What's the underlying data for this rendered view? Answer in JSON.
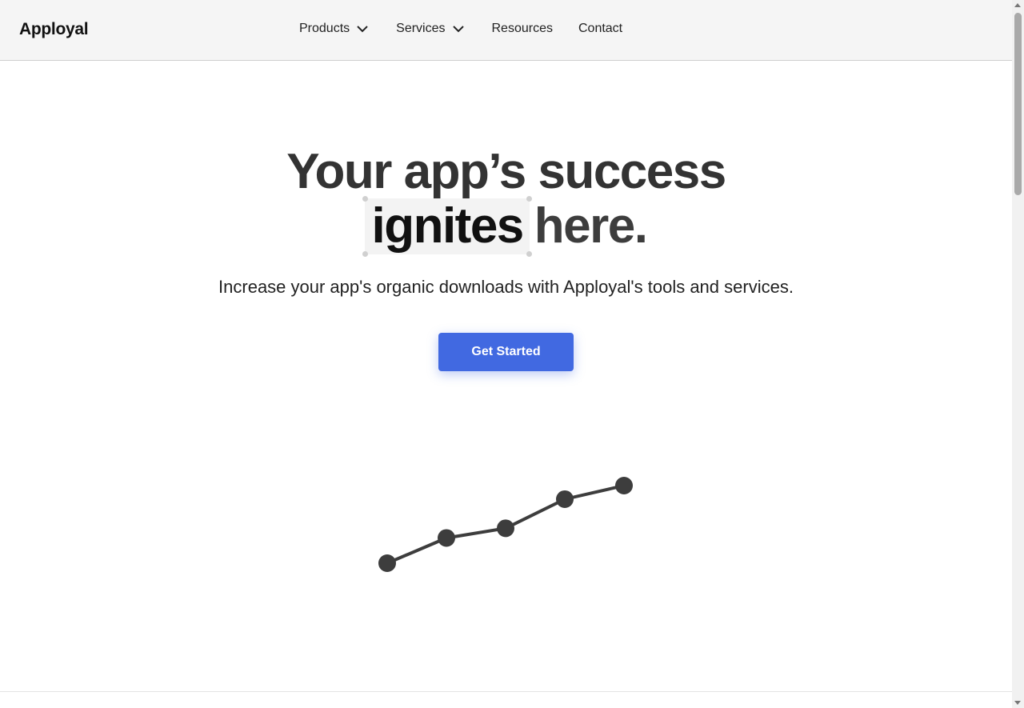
{
  "header": {
    "logo": "Apployal",
    "nav": [
      {
        "label": "Products",
        "has_dropdown": true
      },
      {
        "label": "Services",
        "has_dropdown": true
      },
      {
        "label": "Resources",
        "has_dropdown": false
      },
      {
        "label": "Contact",
        "has_dropdown": false
      }
    ]
  },
  "hero": {
    "line1": "Your app’s success",
    "highlight": "ignites",
    "line2_rest": "here.",
    "subtitle": "Increase your app's organic downloads with Apployal's tools and services.",
    "cta_label": "Get Started"
  },
  "colors": {
    "accent": "#4169e1",
    "text": "#333333",
    "header_bg": "#f5f5f5"
  },
  "growth_graphic": {
    "points": [
      1,
      2.3,
      2.8,
      4.3,
      5
    ]
  }
}
